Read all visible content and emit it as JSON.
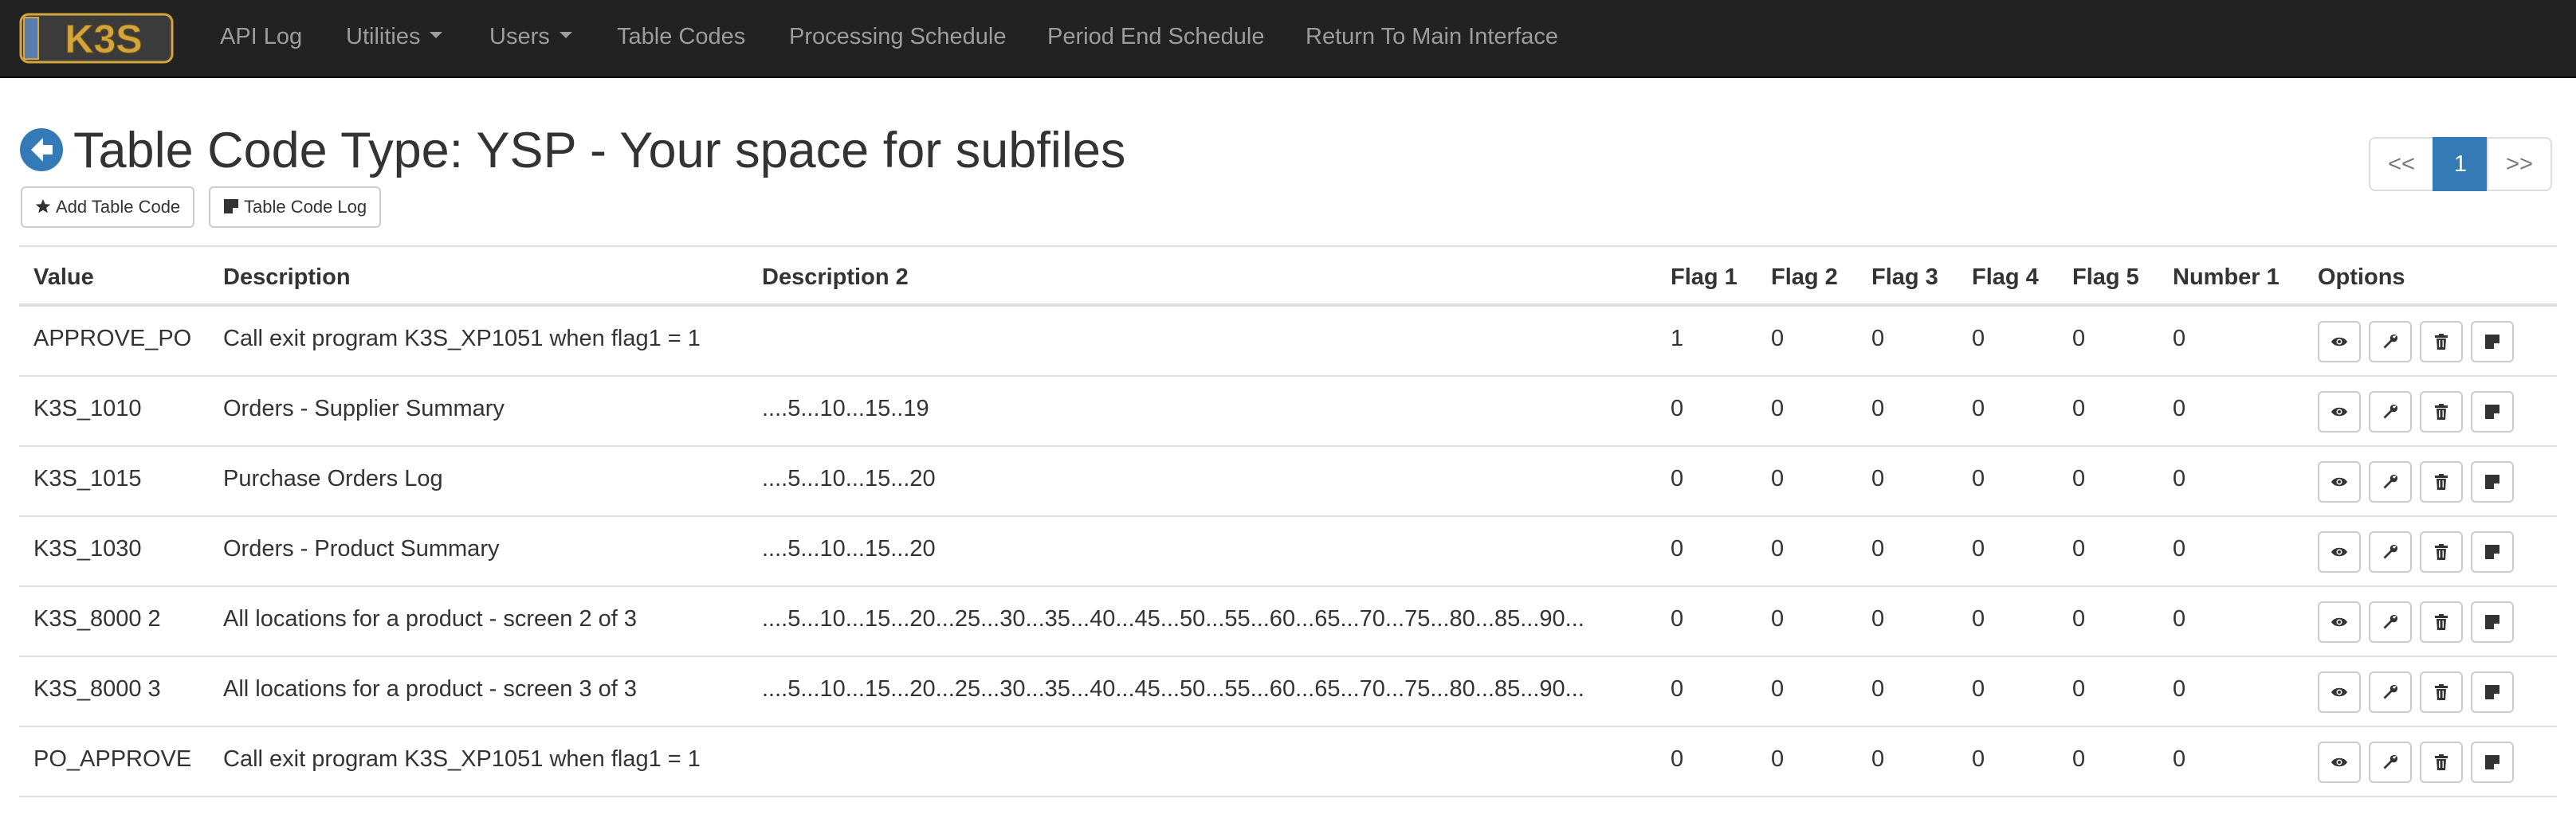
{
  "navbar": {
    "logo_text": "K3S",
    "items": [
      {
        "label": "API Log",
        "dropdown": false
      },
      {
        "label": "Utilities",
        "dropdown": true
      },
      {
        "label": "Users",
        "dropdown": true
      },
      {
        "label": "Table Codes",
        "dropdown": false
      },
      {
        "label": "Processing Schedule",
        "dropdown": false
      },
      {
        "label": "Period End Schedule",
        "dropdown": false
      },
      {
        "label": "Return To Main Interface",
        "dropdown": false
      }
    ]
  },
  "header": {
    "title": "Table Code Type: YSP - Your space for subfiles",
    "back_icon": "circle-arrow-left-icon",
    "add_button": "Add Table Code",
    "add_icon": "star-icon",
    "log_button": "Table Code Log",
    "log_icon": "note-icon"
  },
  "pagination": {
    "prev": "<<",
    "current": "1",
    "next": ">>"
  },
  "table": {
    "headers": [
      "Value",
      "Description",
      "Description 2",
      "Flag 1",
      "Flag 2",
      "Flag 3",
      "Flag 4",
      "Flag 5",
      "Number 1",
      "Options"
    ],
    "option_icons": [
      "eye-icon",
      "wrench-icon",
      "trash-icon",
      "note-icon"
    ],
    "rows": [
      {
        "value": "APPROVE_PO",
        "description": "Call exit program K3S_XP1051 when flag1 = 1",
        "description2": "",
        "flag1": "1",
        "flag2": "0",
        "flag3": "0",
        "flag4": "0",
        "flag5": "0",
        "number1": "0"
      },
      {
        "value": "K3S_1010",
        "description": "Orders - Supplier Summary",
        "description2": "....5...10...15..19",
        "flag1": "0",
        "flag2": "0",
        "flag3": "0",
        "flag4": "0",
        "flag5": "0",
        "number1": "0"
      },
      {
        "value": "K3S_1015",
        "description": "Purchase Orders Log",
        "description2": "....5...10...15...20",
        "flag1": "0",
        "flag2": "0",
        "flag3": "0",
        "flag4": "0",
        "flag5": "0",
        "number1": "0"
      },
      {
        "value": "K3S_1030",
        "description": "Orders - Product Summary",
        "description2": "....5...10...15...20",
        "flag1": "0",
        "flag2": "0",
        "flag3": "0",
        "flag4": "0",
        "flag5": "0",
        "number1": "0"
      },
      {
        "value": "K3S_8000 2",
        "description": "All locations for a product - screen 2 of 3",
        "description2": "....5...10...15...20...25...30...35...40...45...50...55...60...65...70...75...80...85...90...",
        "flag1": "0",
        "flag2": "0",
        "flag3": "0",
        "flag4": "0",
        "flag5": "0",
        "number1": "0"
      },
      {
        "value": "K3S_8000 3",
        "description": "All locations for a product - screen 3 of 3",
        "description2": "....5...10...15...20...25...30...35...40...45...50...55...60...65...70...75...80...85...90...",
        "flag1": "0",
        "flag2": "0",
        "flag3": "0",
        "flag4": "0",
        "flag5": "0",
        "number1": "0"
      },
      {
        "value": "PO_APPROVE",
        "description": "Call exit program K3S_XP1051 when flag1 = 1",
        "description2": "",
        "flag1": "0",
        "flag2": "0",
        "flag3": "0",
        "flag4": "0",
        "flag5": "0",
        "number1": "0"
      }
    ]
  },
  "colors": {
    "navbar_bg": "#222222",
    "nav_text": "#9d9d9d",
    "primary": "#337ab7",
    "back_icon": "#337ab7",
    "logo_gold": "#d4a53c",
    "logo_blue": "#5a7db0"
  }
}
